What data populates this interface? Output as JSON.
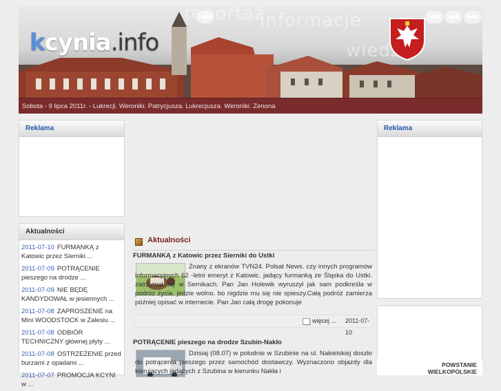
{
  "header": {
    "logo_prefix": "k",
    "logo_main": "cynia",
    "logo_suffix": ".info",
    "ghost_words": [
      "reportaż",
      "informacje",
      "wiedza"
    ],
    "nav_buttons": [
      "◀◀",
      "◀◀",
      "◀◀",
      "▶▶"
    ],
    "date_line": "Sobota - 9 lipca 2011r. - Lukrecji. Weroniki. Patrycjusza. Lukrecjusza. Weroniki. Zenona"
  },
  "left": {
    "ad_title": "Reklama",
    "news_title": "Aktualności",
    "news": [
      {
        "date": "2011-07-10",
        "text": "FURMANKĄ z Katowic przez Sierniki ..."
      },
      {
        "date": "2011-07-09",
        "text": "POTRĄCENIE pieszego na drodze ..."
      },
      {
        "date": "2011-07-09",
        "text": "NIE BĘDĘ KANDYDOWAŁ w jesiennych ..."
      },
      {
        "date": "2011-07-08",
        "text": "ZAPROSZENIE na Mini WOODSTOCK w Zalesiu ..."
      },
      {
        "date": "2011-07-08",
        "text": "ODBIÓR TECHNICZNY głównej płyty ..."
      },
      {
        "date": "2011-07-08",
        "text": "OSTRZEŻENIE przed burzami z opadami ..."
      },
      {
        "date": "2011-07-07",
        "text": "PROMOCJA KCYNI w ..."
      }
    ]
  },
  "right": {
    "ad_title": "Reklama",
    "banner_line1": "POWSTANIE",
    "banner_line2": "WIELKOPOLSKIE"
  },
  "center": {
    "section_title": "Aktualności",
    "articles": [
      {
        "title": "FURMANKĄ z Katowic przez Sierniki do Ustki",
        "body": "Znany z ekranów TVN24. Polsat News. czy innych programów informacyjnych 62 -letni emeryt z Katowic. jadący furmanką ze Śląska do Ustki. zatrzymał się w Sernikach. Pan Jan Holewik wyruszył jak sam podkreśla w podróż życia. jedzie wolno. bo nigdzie mu się nie spieszy.Całą podróż zamierza później opisać w internecie. Pan Jan całą drogę pokonuje",
        "more": "więcej ...",
        "date": "2011-07-10"
      },
      {
        "title": "POTRĄCENIE pieszego na drodze Szubin-Nakło",
        "body": "Dzisiaj (08.07) w południe w Szubinie na ul. Nakielskiej doszło do potrącenia pieszego przez samochód dostawczy. Wyznaczono objazdy dla kierujących jadących z Szubina w kierunku Nakła i"
      }
    ]
  }
}
